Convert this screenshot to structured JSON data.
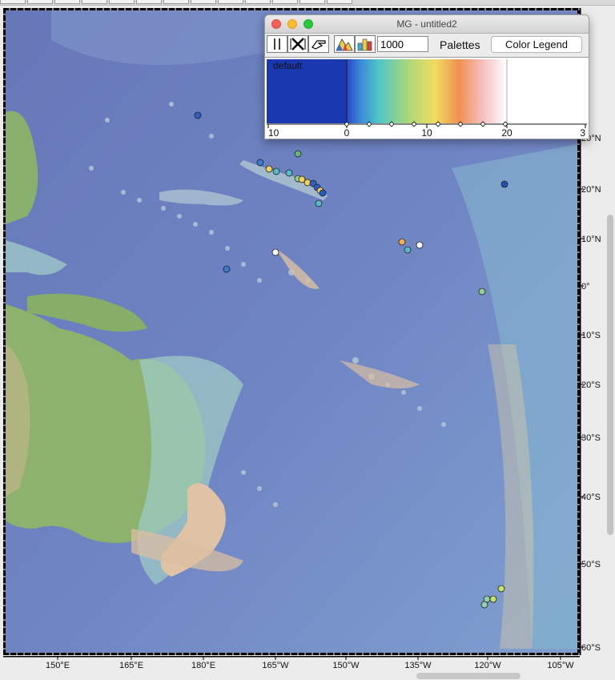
{
  "window": {
    "title": "MG - untitled2",
    "count_value": "1000",
    "palettes_label": "Palettes",
    "color_legend_label": "Color Legend",
    "palette_name": "default",
    "scale_ticks": [
      "10",
      "0",
      "10",
      "20",
      "3"
    ]
  },
  "map": {
    "lon_labels": [
      "150°E",
      "165°E",
      "180°E",
      "165°W",
      "150°W",
      "135°W",
      "120°W",
      "105°W"
    ],
    "lat_labels": [
      "20°N",
      "20°N",
      "10°N",
      "0°",
      "10°S",
      "20°S",
      "30°S",
      "40°S",
      "50°S",
      "60°S"
    ],
    "colors": {
      "ocean_deep": "#6f7fc0",
      "ocean_mid": "#7a9bd0",
      "shelf": "#8cc5cf",
      "land": "#8fb86d",
      "ridge": "#e6b69b"
    }
  }
}
